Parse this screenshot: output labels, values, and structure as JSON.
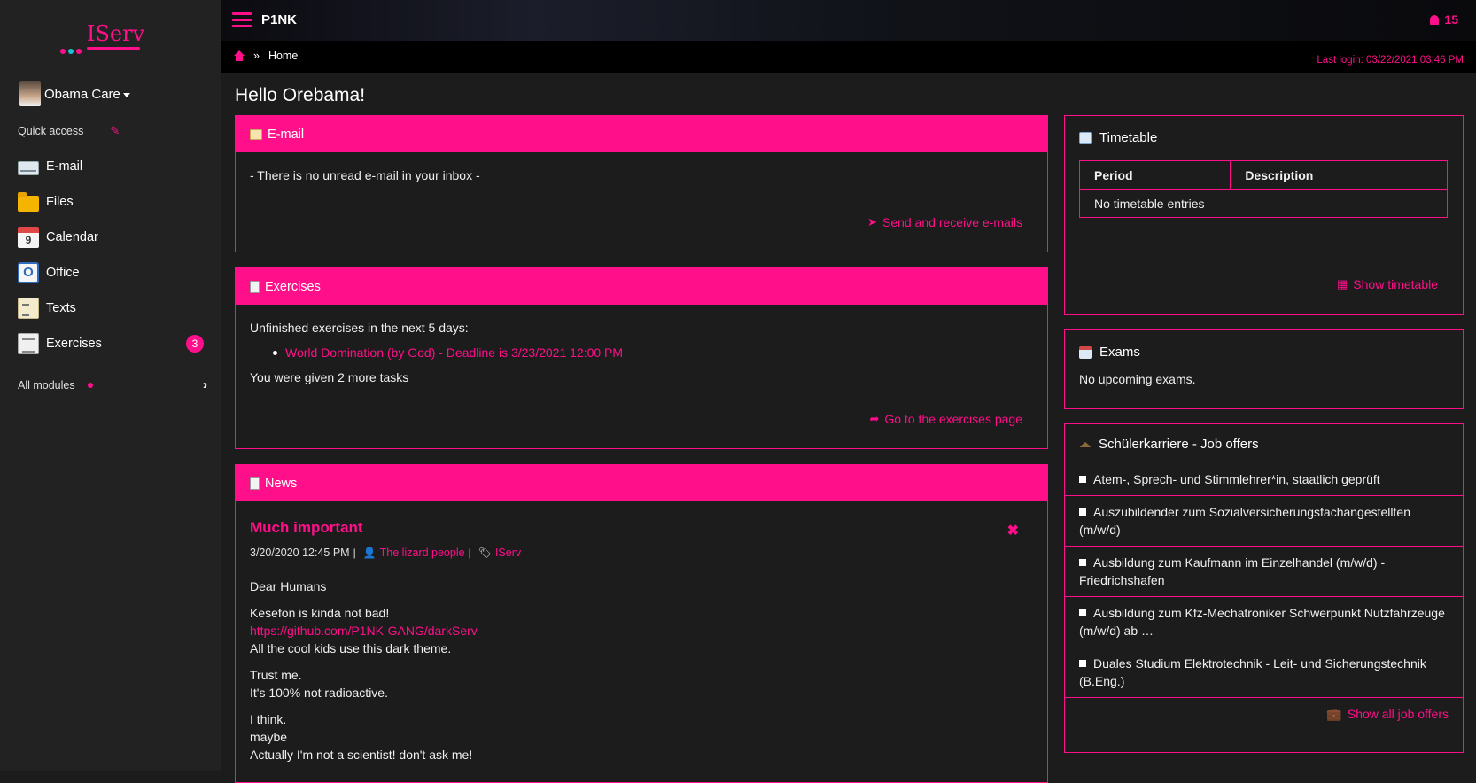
{
  "colors": {
    "accent": "#ff0f8a",
    "background": "#1c1c1c",
    "sidebar": "#222222"
  },
  "logo": {
    "text": "IServ",
    "dot_colors": [
      "#ff0f8a",
      "#20c0d0",
      "#ff0f8a"
    ]
  },
  "sidebar": {
    "user": {
      "name": "Obama Care"
    },
    "quick_access": {
      "label": "Quick access",
      "edit_icon": "pencil-icon"
    },
    "items": [
      {
        "label": "E-mail",
        "icon": "mail-icon"
      },
      {
        "label": "Files",
        "icon": "folder-icon"
      },
      {
        "label": "Calendar",
        "icon": "calendar-icon",
        "icon_text": "9"
      },
      {
        "label": "Office",
        "icon": "office-icon",
        "icon_text": "O"
      },
      {
        "label": "Texts",
        "icon": "texts-icon"
      },
      {
        "label": "Exercises",
        "icon": "exercises-icon",
        "badge": "3"
      }
    ],
    "all_modules": "All modules"
  },
  "topbar": {
    "title": "P1NK",
    "notifications": "15"
  },
  "breadcrumb": {
    "separator": "»",
    "current": "Home"
  },
  "last_login": "Last login: 03/22/2021 03:46 PM",
  "greeting": "Hello Orebama!",
  "email_panel": {
    "title": "E-mail",
    "message": "- There is no unread e-mail in your inbox -",
    "action": "Send and receive e-mails"
  },
  "exercises_panel": {
    "title": "Exercises",
    "intro": "Unfinished exercises in the next 5 days:",
    "tasks": [
      "World Domination (by God) - Deadline is 3/23/2021 12:00 PM"
    ],
    "more": "You were given 2 more tasks",
    "action": "Go to the exercises page"
  },
  "news_panel": {
    "title": "News",
    "post": {
      "title": "Much important",
      "date": "3/20/2020 12:45 PM",
      "author": "The lizard people",
      "tag": "IServ",
      "greeting": "Dear Humans",
      "line1": "Kesefon is kinda not bad!",
      "link": "https://github.com/P1NK-GANG/darkServ",
      "line2": "All the cool kids use this dark theme.",
      "line3": "Trust me.",
      "line4": "It's 100% not radioactive.",
      "line5": "I think.",
      "line6": "maybe",
      "line7": "Actually I'm not a scientist! don't ask me!"
    }
  },
  "timetable_panel": {
    "title": "Timetable",
    "columns": [
      "Period",
      "Description"
    ],
    "empty": "No timetable entries",
    "action": "Show timetable"
  },
  "exams_panel": {
    "title": "Exams",
    "empty": "No upcoming exams."
  },
  "jobs_panel": {
    "title": "Schülerkarriere - Job offers",
    "items": [
      "Atem-, Sprech- und Stimmlehrer*in, staatlich geprüft",
      "Auszubildender zum Sozialversicherungsfachangestellten (m/w/d)",
      "Ausbildung zum Kaufmann im Einzelhandel (m/w/d) - Friedrichshafen",
      "Ausbildung zum Kfz-Mechatroniker Schwerpunkt Nutzfahrzeuge (m/w/d) ab …",
      "Duales Studium Elektrotechnik - Leit- und Sicherungstechnik (B.Eng.)"
    ],
    "action": "Show all job offers"
  }
}
